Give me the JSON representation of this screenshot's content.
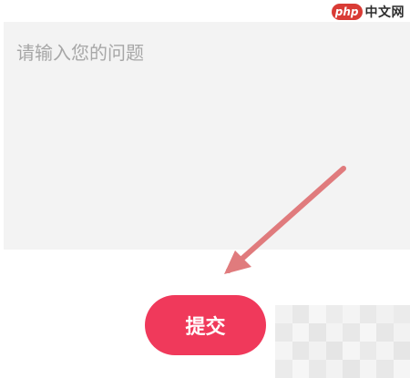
{
  "question_form": {
    "input_placeholder": "请输入您的问题",
    "input_value": ""
  },
  "submit_button": {
    "label": "提交"
  },
  "watermark": {
    "badge": "php",
    "text": "中文网"
  },
  "colors": {
    "accent": "#f0395b",
    "arrow": "#e07b7d",
    "input_background": "#f3f3f3",
    "placeholder": "#a7a7a7",
    "watermark_red": "#d93b35"
  },
  "icons": {
    "annotation_arrow": "arrow-down-left-icon"
  }
}
